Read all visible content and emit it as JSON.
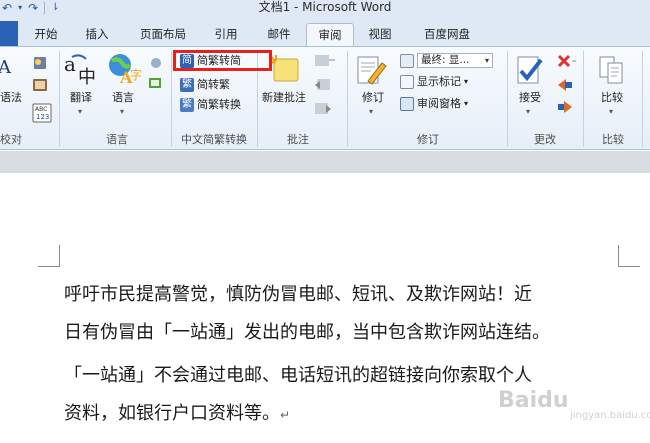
{
  "window": {
    "title": "文档1 - Microsoft Word"
  },
  "quick_access": {
    "undo_glyph": "↶",
    "undo_more": "▾",
    "redo_glyph": "↷",
    "customize": "⇂"
  },
  "tabs": [
    {
      "label": "开始"
    },
    {
      "label": "插入"
    },
    {
      "label": "页面布局"
    },
    {
      "label": "引用"
    },
    {
      "label": "邮件"
    },
    {
      "label": "审阅",
      "active": true
    },
    {
      "label": "视图"
    },
    {
      "label": "百度网盘"
    }
  ],
  "ribbon": {
    "proofing": {
      "spelling_label": "语法",
      "group_label": "校对"
    },
    "language": {
      "translate_label": "翻译",
      "language_label": "语言",
      "group_label": "语言"
    },
    "chinese_conversion": {
      "trad_to_simp": "简繁转简",
      "simp_to_trad": "简转繁",
      "convert": "简繁转换",
      "group_label": "中文简繁转换"
    },
    "comments": {
      "new_comment": "新建批注",
      "group_label": "批注"
    },
    "tracking": {
      "track_changes": "修订",
      "display_combo": "最终: 显...",
      "show_markup": "显示标记",
      "reviewing_pane": "审阅窗格",
      "group_label": "修订"
    },
    "changes": {
      "accept": "接受",
      "group_label": "更改"
    },
    "compare": {
      "compare": "比较",
      "group_label": "比较"
    }
  },
  "document": {
    "lines": [
      "呼吁市民提高警觉，慎防伪冒电邮、短讯、及欺诈网站！近",
      "日有伪冒由「一站通」发出的电邮，当中包含欺诈网站连结。",
      "「一站通」不会通过电邮、电话短讯的超链接向你索取个人",
      "资料，如银行户口资料等。"
    ],
    "paragraph_mark": "↵"
  },
  "watermark": {
    "text": "Baidu",
    "sub": "jingyan.baidu.com"
  },
  "colors": {
    "highlight": "#e8211d",
    "accent": "#2a62b6"
  }
}
